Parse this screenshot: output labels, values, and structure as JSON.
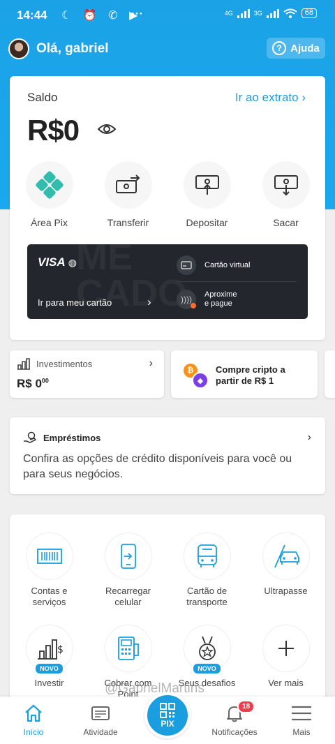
{
  "status": {
    "time": "14:44",
    "net1": "4G",
    "net2": "3G",
    "battery": "68",
    "more": "···"
  },
  "header": {
    "greeting": "Olá, gabriel",
    "help_label": "Ajuda"
  },
  "balance": {
    "label": "Saldo",
    "statement_link": "Ir ao extrato",
    "amount": "R$0",
    "actions": [
      {
        "label": "Área Pix",
        "icon": "pix-icon"
      },
      {
        "label": "Transferir",
        "icon": "transfer-icon"
      },
      {
        "label": "Depositar",
        "icon": "deposit-icon"
      },
      {
        "label": "Sacar",
        "icon": "withdraw-icon"
      }
    ]
  },
  "card_banner": {
    "brand": "VISA",
    "go_to_card": "Ir para meu cartão",
    "virtual_card": "Cartão virtual",
    "contactless_line1": "Aproxime",
    "contactless_line2": "e pague"
  },
  "investments": {
    "title": "Investimentos",
    "value": "R$ 0",
    "cents": "00"
  },
  "crypto": {
    "text": "Compre cripto a partir de R$ 1"
  },
  "loans": {
    "title": "Empréstimos",
    "description": "Confira as opções de crédito disponíveis para você ou para seus negócios."
  },
  "services": [
    {
      "label": "Contas e serviços",
      "icon": "barcode-icon"
    },
    {
      "label": "Recarregar celular",
      "icon": "phone-recharge-icon"
    },
    {
      "label": "Cartão de transporte",
      "icon": "bus-icon"
    },
    {
      "label": "Ultrapasse",
      "icon": "car-icon"
    },
    {
      "label": "Investir",
      "icon": "invest-chart-icon",
      "badge": "NOVO"
    },
    {
      "label": "Cobrar com Point",
      "icon": "point-machine-icon"
    },
    {
      "label": "Seus desafios",
      "icon": "medal-icon",
      "badge": "NOVO"
    },
    {
      "label": "Ver mais",
      "icon": "plus-icon"
    }
  ],
  "watermark": "@GabrielMartins",
  "nav": {
    "home": "Início",
    "activity": "Atividade",
    "pix": "PIX",
    "notifications": "Notificações",
    "notifications_count": "18",
    "more": "Mais"
  },
  "colors": {
    "brand_blue": "#1a9ee0",
    "header_blue": "#1ba2e6",
    "card_dark": "#23262c",
    "alert_red": "#f23d4f"
  }
}
